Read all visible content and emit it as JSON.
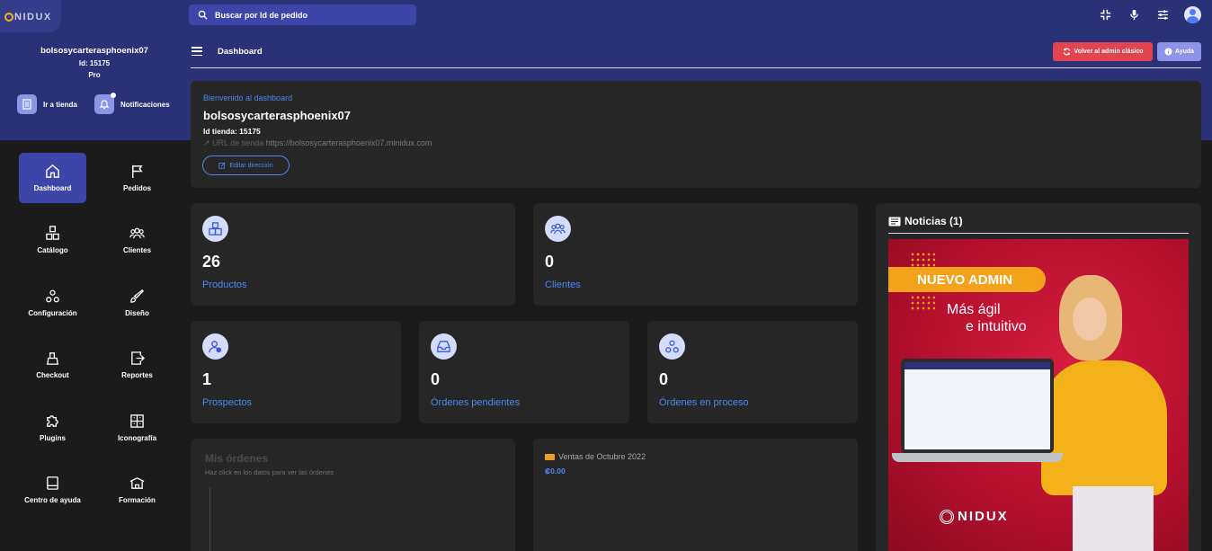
{
  "app": {
    "logo": "NIDUX"
  },
  "search": {
    "placeholder": "Buscar por Id de pedido"
  },
  "store": {
    "name": "bolsosycarterasphoenix07",
    "id": "Id: 15175",
    "plan": "Pro"
  },
  "quick": {
    "store": "Ir a tienda",
    "notifications": "Notificaciones"
  },
  "nav": [
    {
      "label": "Dashboard",
      "icon": "home-icon"
    },
    {
      "label": "Pedidos",
      "icon": "flag-icon"
    },
    {
      "label": "Catálogo",
      "icon": "boxes-icon"
    },
    {
      "label": "Clientes",
      "icon": "users-icon"
    },
    {
      "label": "Configuración",
      "icon": "nodes-icon"
    },
    {
      "label": "Diseño",
      "icon": "brush-icon"
    },
    {
      "label": "Checkout",
      "icon": "register-icon"
    },
    {
      "label": "Reportes",
      "icon": "report-icon"
    },
    {
      "label": "Plugins",
      "icon": "puzzle-icon"
    },
    {
      "label": "Iconografía",
      "icon": "grid-icon"
    },
    {
      "label": "Centro de ayuda",
      "icon": "book-icon"
    },
    {
      "label": "Formación",
      "icon": "school-icon"
    }
  ],
  "header": {
    "breadcrumb": "Dashboard",
    "classic_btn": "Volver al admin clásico",
    "help_btn": "Ayuda"
  },
  "welcome": {
    "greeting": "Bienvenido al dashboard",
    "name": "bolsosycarterasphoenix07",
    "store_id": "Id tienda: 15175",
    "url_label": "URL de tienda",
    "url": "https://bolsosycarterasphoenix07.minidux.com",
    "edit_btn": "Editar dirección"
  },
  "stats": [
    {
      "value": "26",
      "label": "Productos"
    },
    {
      "value": "0",
      "label": "Clientes"
    },
    {
      "value": "1",
      "label": "Prospectos"
    },
    {
      "value": "0",
      "label": "Órdenes pendientes"
    },
    {
      "value": "0",
      "label": "Órdenes en proceso"
    }
  ],
  "orders": {
    "title": "Mis órdenes",
    "subtitle": "Haz click en los datos para ver las órdenes"
  },
  "sales": {
    "title": "Ventas de Octubre 2022",
    "value": "₡0.00"
  },
  "news": {
    "title": "Noticias (1)",
    "badge": "NUEVO ADMIN",
    "line1": "Más ágil",
    "line2": "e intuitivo",
    "brand": "NIDUX"
  },
  "colors": {
    "primary": "#2a3177",
    "accent": "#4d8af2",
    "danger": "#e2454f",
    "card": "#262626"
  }
}
